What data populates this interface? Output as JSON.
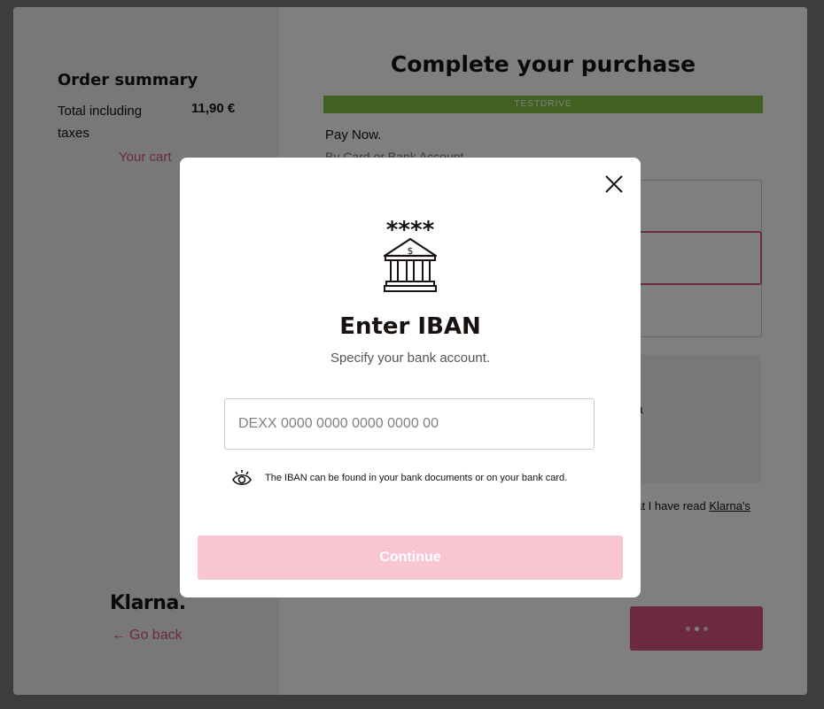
{
  "colors": {
    "accent": "#d9547f",
    "accent_disabled": "#f8c5d3",
    "testdrive_banner": "#83c341",
    "text": "#17120f"
  },
  "sidebar": {
    "order_summary_title": "Order summary",
    "total_label": "Total including taxes",
    "total_amount": "11,90 €",
    "cart_link": "Your cart",
    "logo": "Klarna.",
    "go_back_arrow": "←",
    "go_back_label": "Go back"
  },
  "main": {
    "title": "Complete your purchase",
    "testdrive_banner": "TESTDRIVE",
    "payment_method_title": "Pay Now.",
    "payment_method_subtitle": "By Card or Bank Account",
    "info_fragment": "na",
    "terms_fragment": "hat I have read",
    "terms_link": "Klarna's"
  },
  "modal": {
    "icon": "bank-icon",
    "masked_digits": "****",
    "title": "Enter IBAN",
    "subtitle": "Specify your bank account.",
    "iban_placeholder": "DEXX 0000 0000 0000 0000 00",
    "iban_value": "",
    "hint_icon": "eye-icon",
    "hint_text": "The IBAN can be found in your bank documents or on your bank card.",
    "continue_label": "Continue",
    "close_icon": "close-icon"
  }
}
